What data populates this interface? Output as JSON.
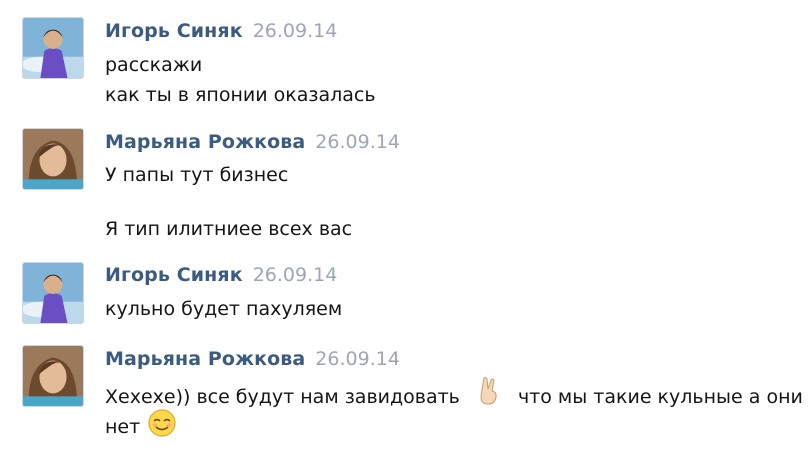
{
  "messages": [
    {
      "author": "Игорь Синяк",
      "date": "26.09.14",
      "lines": [
        "расскажи",
        "как ты в японии оказалась"
      ]
    },
    {
      "author": "Марьяна Рожкова",
      "date": "26.09.14",
      "lines": [
        "У папы тут бизнес",
        "Я тип илитниее всех вас"
      ]
    },
    {
      "author": "Игорь Синяк",
      "date": "26.09.14",
      "lines": [
        "кульно будет пахуляем"
      ]
    },
    {
      "author": "Марьяна Рожкова",
      "date": "26.09.14",
      "lines": [
        "Хехехе)) все будут нам завидовать",
        "что мы такие кульные а они",
        "нет"
      ]
    }
  ],
  "emojis": [
    "victory-hand-icon",
    "relieved-face-icon"
  ],
  "colors": {
    "author": "#3b5b80",
    "date": "#9fa6b0",
    "text": "#151515"
  }
}
